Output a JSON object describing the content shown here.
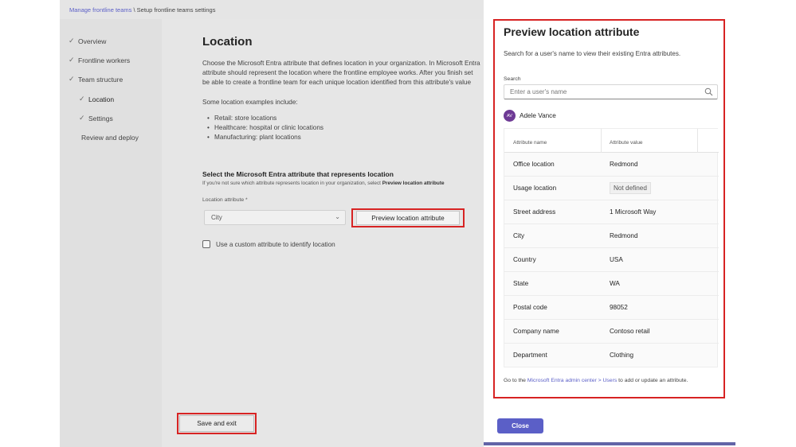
{
  "breadcrumb": {
    "parent": "Manage frontline teams",
    "separator": " \\ ",
    "current": "Setup frontline teams settings"
  },
  "nav": [
    {
      "label": "Overview",
      "checked": true
    },
    {
      "label": "Frontline workers",
      "checked": true
    },
    {
      "label": "Team structure",
      "checked": true
    },
    {
      "label": "Location",
      "checked": true
    },
    {
      "label": "Settings",
      "checked": true
    },
    {
      "label": "Review and deploy",
      "checked": false
    }
  ],
  "content": {
    "title": "Location",
    "desc_lines": [
      "Choose the Microsoft Entra attribute that defines location in your organization. In Microsoft Entra",
      "attribute should represent the location where the frontline employee works. After you finish set",
      "be able to create a frontline team for each unique location identified from this attribute's value"
    ],
    "examples_intro": "Some location examples include:",
    "examples": [
      "Retail: store locations",
      "Healthcare: hospital or clinic locations",
      "Manufacturing: plant locations"
    ],
    "select_heading": "Select the Microsoft Entra attribute that represents location",
    "hint_prefix": "If you're not sure which attribute represents location in your organization, select ",
    "hint_bold": "Preview location attribute",
    "field_label": "Location attribute *",
    "selected_value": "City",
    "preview_button": "Preview location attribute",
    "custom_checkbox_label": "Use a custom attribute to identify location",
    "save_button": "Save and exit"
  },
  "panel": {
    "title": "Preview location attribute",
    "subtitle": "Search for a user's name to view their existing Entra attributes.",
    "search_label": "Search",
    "search_placeholder": "Enter a user's name",
    "user_initials": "AV",
    "user_name": "Adele Vance",
    "table_headers": {
      "name": "Attribute name",
      "value": "Attribute value"
    },
    "rows": [
      {
        "name": "Office location",
        "value": "Redmond"
      },
      {
        "name": "Usage location",
        "value": "Not defined"
      },
      {
        "name": "Street address",
        "value": "1 Microsoft Way"
      },
      {
        "name": "City",
        "value": "Redmond"
      },
      {
        "name": "Country",
        "value": "USA"
      },
      {
        "name": "State",
        "value": "WA"
      },
      {
        "name": "Postal code",
        "value": "98052"
      },
      {
        "name": "Company name",
        "value": "Contoso retail"
      },
      {
        "name": "Department",
        "value": "Clothing"
      }
    ],
    "footer_prefix": "Go to the ",
    "footer_link": "Microsoft Entra admin center > Users",
    "footer_suffix": " to add or update an attribute.",
    "close_button": "Close"
  },
  "colors": {
    "accent": "#5b5fc7",
    "highlight": "#d72323",
    "avatar": "#6e3a95"
  }
}
